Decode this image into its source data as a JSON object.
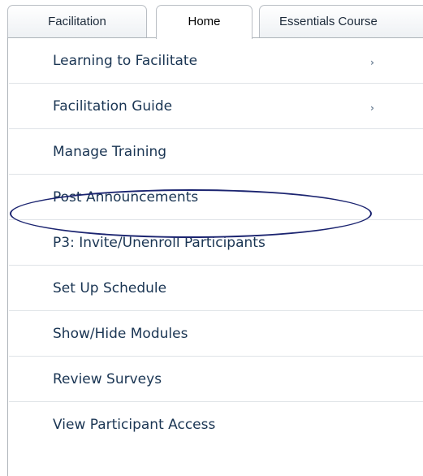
{
  "tabs": [
    {
      "label": "Facilitation",
      "active": false
    },
    {
      "label": "Home",
      "active": true
    },
    {
      "label": "Essentials Course",
      "active": false
    }
  ],
  "menu": {
    "items": [
      {
        "label": "Learning to Facilitate",
        "has_submenu": true,
        "arrow_icon": "›"
      },
      {
        "label": "Facilitation Guide",
        "has_submenu": true,
        "arrow_icon": "›"
      },
      {
        "label": "Manage Training",
        "has_submenu": false
      },
      {
        "label": "Post Announcements",
        "has_submenu": false,
        "circled": true
      },
      {
        "label": "P3: Invite/Unenroll Participants",
        "has_submenu": false
      },
      {
        "label": "Set Up Schedule",
        "has_submenu": false
      },
      {
        "label": "Show/Hide Modules",
        "has_submenu": false
      },
      {
        "label": "Review Surveys",
        "has_submenu": false
      },
      {
        "label": "View Participant Access",
        "has_submenu": false
      }
    ]
  },
  "colors": {
    "menu_text": "#1a3553",
    "highlight_ellipse": "#1b2470",
    "tab_border": "#b9bec4"
  }
}
